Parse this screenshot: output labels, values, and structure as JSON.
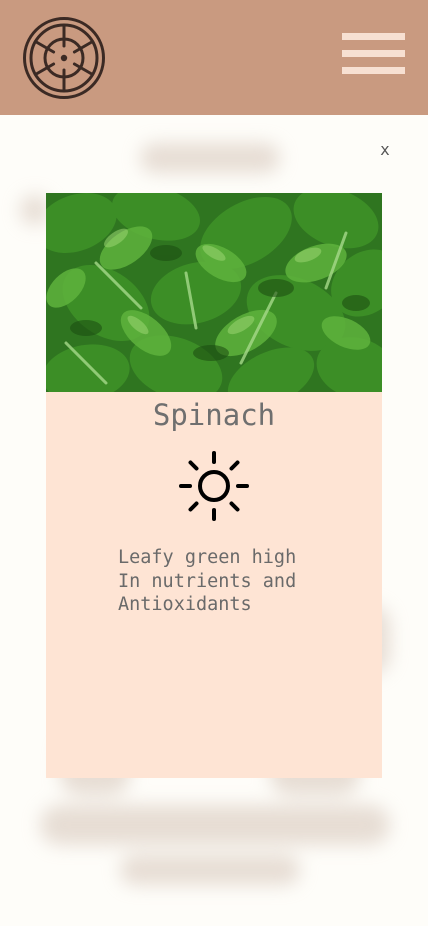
{
  "header": {
    "logo_icon": "ship-wheel-icon",
    "menu_icon": "hamburger-menu-icon",
    "background_color": "#c99a80"
  },
  "modal": {
    "close_label": "x",
    "image_icon": "spinach-leaves-photo",
    "title": "Spinach",
    "condition_icon": "sun-icon",
    "description": "Leafy green high\nIn nutrients and\nAntioxidants",
    "background_color": "#fee4d4"
  }
}
